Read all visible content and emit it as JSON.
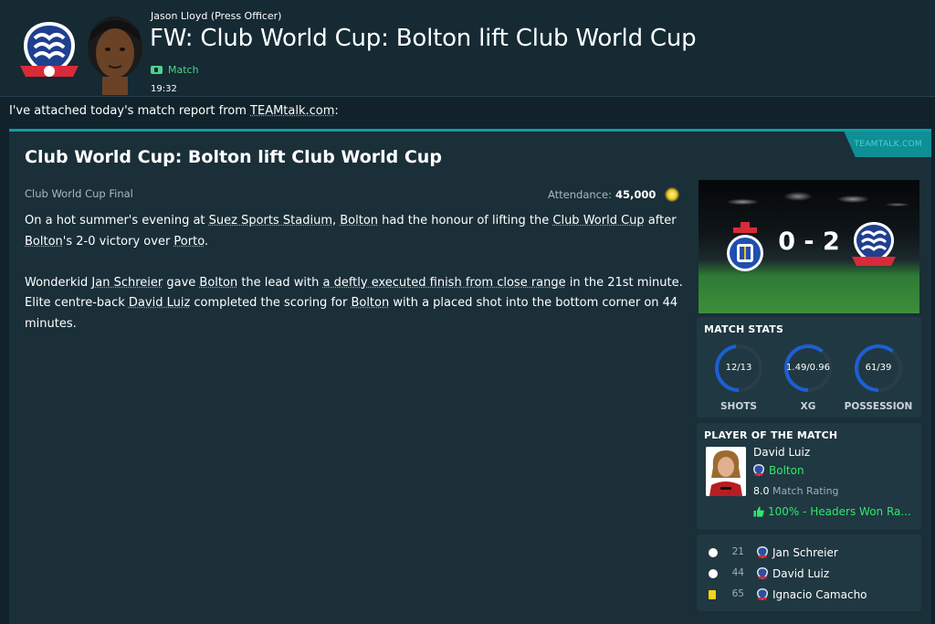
{
  "header": {
    "sender": "Jason Lloyd  (Press Officer)",
    "headline": "FW: Club World Cup: Bolton lift Club World Cup",
    "tag": "Match",
    "time": "19:32"
  },
  "intro": {
    "prefix": "I've attached today's match report from ",
    "source": "TEAMtalk.com",
    "suffix": ":"
  },
  "report": {
    "source_tab": "TEAMTALK.COM",
    "title": "Club World Cup: Bolton lift Club World Cup",
    "competition": "Club World Cup Final",
    "attendance_label": "Attendance:",
    "attendance_value": "45,000",
    "p1": {
      "t1": "On a hot summer's evening at ",
      "stadium": "Suez Sports Stadium",
      "t2": ", ",
      "team1": "Bolton",
      "t3": " had the honour of lifting the ",
      "competition": "Club World Cup",
      "t4": " after ",
      "team2": "Bolton",
      "t5": "'s 2-0 victory over ",
      "team3": "Porto",
      "t6": "."
    },
    "p2": {
      "t1": "Wonderkid ",
      "player1": "Jan Schreier",
      "t2": " gave ",
      "team1": "Bolton",
      "t3": " the lead with ",
      "finish": "a deftly executed finish from close range",
      "t4": " in the 21st minute. Elite centre-back ",
      "player2": "David Luiz",
      "t5": " completed the scoring for ",
      "team2": "Bolton",
      "t6": " with a placed shot into the bottom corner on 44 minutes."
    }
  },
  "scoreboard": {
    "score": "0 - 2"
  },
  "match_stats": {
    "title": "MATCH STATS",
    "items": [
      {
        "value": "12/13",
        "label": "SHOTS",
        "home_share": 0.48
      },
      {
        "value": "1.49/0.96",
        "label": "XG",
        "home_share": 0.61
      },
      {
        "value": "61/39",
        "label": "POSSESSION",
        "home_share": 0.61
      }
    ],
    "home_color": "#1c5fd6",
    "away_color": "#2a3e48"
  },
  "potm": {
    "title": "PLAYER OF THE MATCH",
    "name": "David Luiz",
    "club": "Bolton",
    "rating": "8.0",
    "rating_label": "Match Rating",
    "feature": "100% - Headers Won Ra..."
  },
  "events": [
    {
      "type": "goal",
      "icon": "football-icon",
      "minute": "21",
      "player": "Jan Schreier"
    },
    {
      "type": "goal",
      "icon": "football-icon",
      "minute": "44",
      "player": "David Luiz"
    },
    {
      "type": "yellow",
      "icon": "yellow-card-icon",
      "minute": "65",
      "player": "Ignacio Camacho"
    }
  ],
  "colors": {
    "accent": "#0e9ea3",
    "positive": "#2ee86b",
    "tag": "#4fd18b"
  }
}
